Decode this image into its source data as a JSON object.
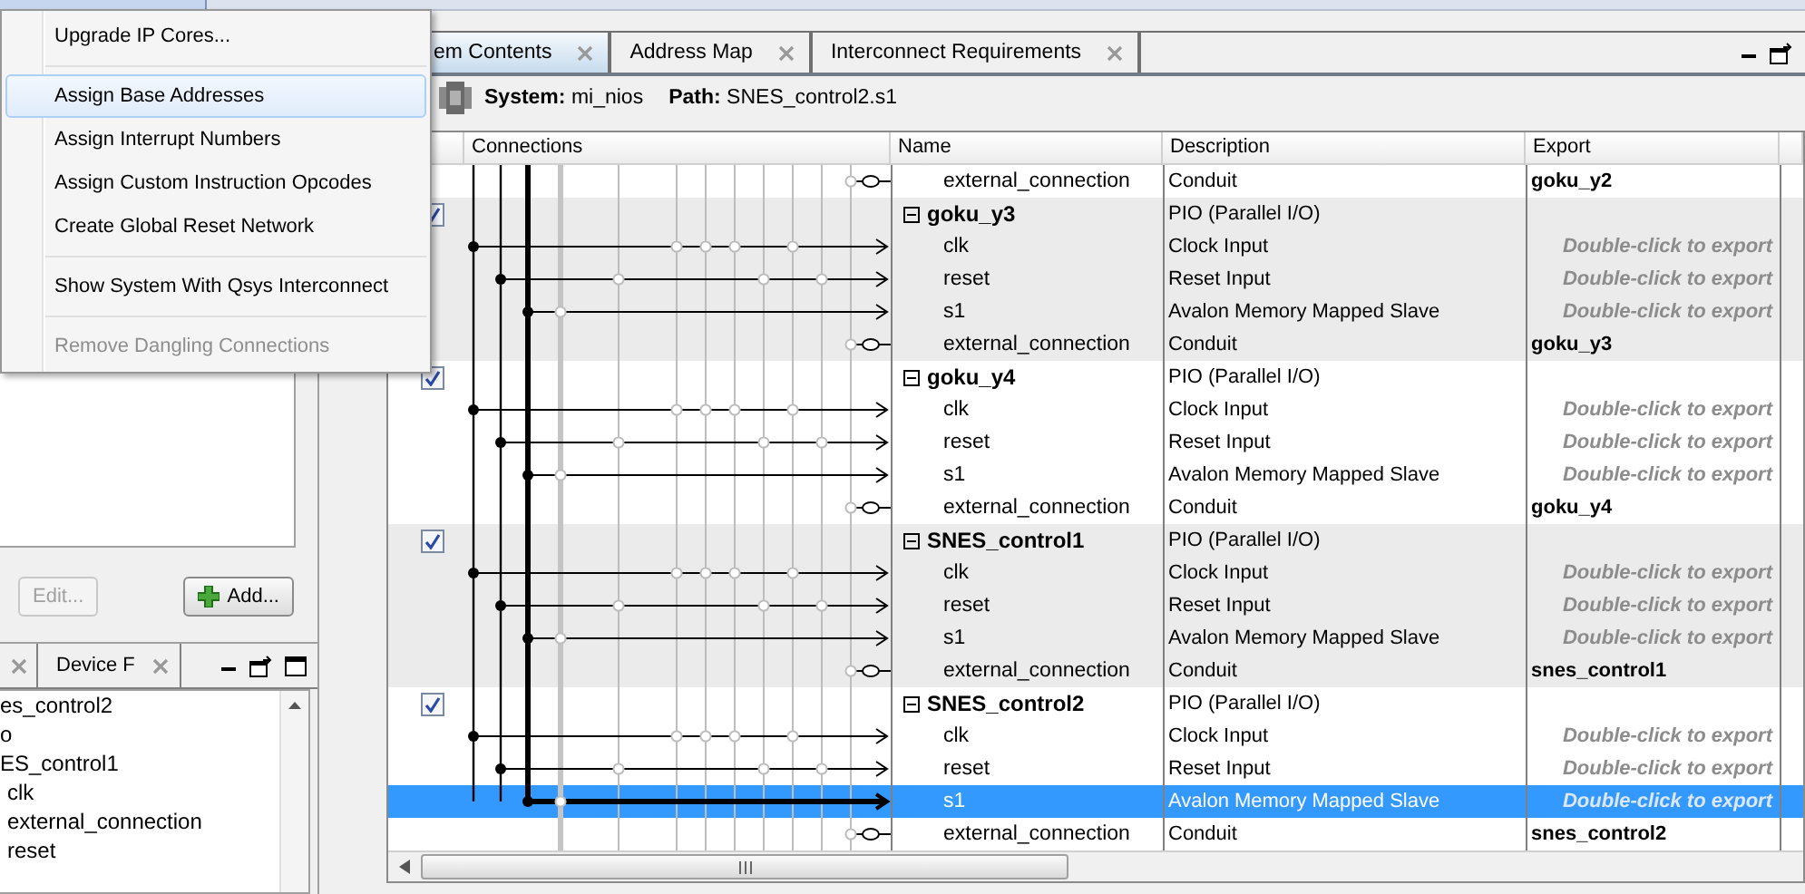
{
  "menu": [
    {
      "kind": "item",
      "label": "Upgrade IP Cores...",
      "selected": false,
      "disabled": false
    },
    {
      "kind": "separator"
    },
    {
      "kind": "item",
      "label": "Assign Base Addresses",
      "selected": true,
      "disabled": false
    },
    {
      "kind": "item",
      "label": "Assign Interrupt Numbers",
      "selected": false,
      "disabled": false
    },
    {
      "kind": "item",
      "label": "Assign Custom Instruction Opcodes",
      "selected": false,
      "disabled": false
    },
    {
      "kind": "item",
      "label": "Create Global Reset Network",
      "selected": false,
      "disabled": false
    },
    {
      "kind": "separator"
    },
    {
      "kind": "item",
      "label": "Show System With Qsys Interconnect",
      "selected": false,
      "disabled": false
    },
    {
      "kind": "separator"
    },
    {
      "kind": "item",
      "label": "Remove Dangling Connections",
      "selected": false,
      "disabled": true
    }
  ],
  "left_buttons": [
    {
      "kind": "plain",
      "label": "Edit...",
      "disabled": true
    },
    {
      "kind": "add",
      "label": "Add...",
      "disabled": false
    }
  ],
  "left_tabs": [
    {
      "label": "Device F",
      "selected": false
    }
  ],
  "tree": [
    {
      "label": "es_control2"
    },
    {
      "label": "o"
    },
    {
      "label": "ES_control1",
      "children": [
        {
          "label": "clk"
        },
        {
          "label": "external_connection"
        },
        {
          "label": "reset"
        }
      ]
    }
  ],
  "tabs": [
    {
      "label": "em Contents",
      "selected": true
    },
    {
      "label": "Address Map",
      "selected": false
    },
    {
      "label": "Interconnect Requirements",
      "selected": false
    }
  ],
  "path_bar": {
    "system_label": "System:",
    "system": "mi_nios",
    "path_label": "Path:",
    "path": "SNES_control2.s1"
  },
  "columns": [
    "Connections",
    "Name",
    "Description",
    "Export"
  ],
  "rows": [
    {
      "kind": "conduit",
      "name": "external_connection",
      "description": "Conduit",
      "export": "goku_y2",
      "exported": true,
      "selected": false
    },
    {
      "kind": "module",
      "name": "goku_y3",
      "description": "PIO (Parallel I/O)",
      "checked": true,
      "expanded": true,
      "selected": false
    },
    {
      "kind": "clock",
      "name": "clk",
      "description": "Clock Input",
      "export": "Double-click to export",
      "exported": false,
      "selected": false
    },
    {
      "kind": "reset",
      "name": "reset",
      "description": "Reset Input",
      "export": "Double-click to export",
      "exported": false,
      "selected": false
    },
    {
      "kind": "slave",
      "name": "s1",
      "description": "Avalon Memory Mapped Slave",
      "export": "Double-click to export",
      "exported": false,
      "selected": false
    },
    {
      "kind": "conduit",
      "name": "external_connection",
      "description": "Conduit",
      "export": "goku_y3",
      "exported": true,
      "selected": false
    },
    {
      "kind": "module",
      "name": "goku_y4",
      "description": "PIO (Parallel I/O)",
      "checked": true,
      "expanded": true,
      "selected": false
    },
    {
      "kind": "clock",
      "name": "clk",
      "description": "Clock Input",
      "export": "Double-click to export",
      "exported": false,
      "selected": false
    },
    {
      "kind": "reset",
      "name": "reset",
      "description": "Reset Input",
      "export": "Double-click to export",
      "exported": false,
      "selected": false
    },
    {
      "kind": "slave",
      "name": "s1",
      "description": "Avalon Memory Mapped Slave",
      "export": "Double-click to export",
      "exported": false,
      "selected": false
    },
    {
      "kind": "conduit",
      "name": "external_connection",
      "description": "Conduit",
      "export": "goku_y4",
      "exported": true,
      "selected": false
    },
    {
      "kind": "module",
      "name": "SNES_control1",
      "description": "PIO (Parallel I/O)",
      "checked": true,
      "expanded": true,
      "selected": false
    },
    {
      "kind": "clock",
      "name": "clk",
      "description": "Clock Input",
      "export": "Double-click to export",
      "exported": false,
      "selected": false
    },
    {
      "kind": "reset",
      "name": "reset",
      "description": "Reset Input",
      "export": "Double-click to export",
      "exported": false,
      "selected": false
    },
    {
      "kind": "slave",
      "name": "s1",
      "description": "Avalon Memory Mapped Slave",
      "export": "Double-click to export",
      "exported": false,
      "selected": false
    },
    {
      "kind": "conduit",
      "name": "external_connection",
      "description": "Conduit",
      "export": "snes_control1",
      "exported": true,
      "selected": false
    },
    {
      "kind": "module",
      "name": "SNES_control2",
      "description": "PIO (Parallel I/O)",
      "checked": true,
      "expanded": true,
      "selected": false
    },
    {
      "kind": "clock",
      "name": "clk",
      "description": "Clock Input",
      "export": "Double-click to export",
      "exported": false,
      "selected": false
    },
    {
      "kind": "reset",
      "name": "reset",
      "description": "Reset Input",
      "export": "Double-click to export",
      "exported": false,
      "selected": false
    },
    {
      "kind": "slave",
      "name": "s1",
      "description": "Avalon Memory Mapped Slave",
      "export": "Double-click to export",
      "exported": false,
      "selected": true
    },
    {
      "kind": "conduit",
      "name": "external_connection",
      "description": "Conduit",
      "export": "snes_control2",
      "exported": true,
      "selected": false
    }
  ]
}
